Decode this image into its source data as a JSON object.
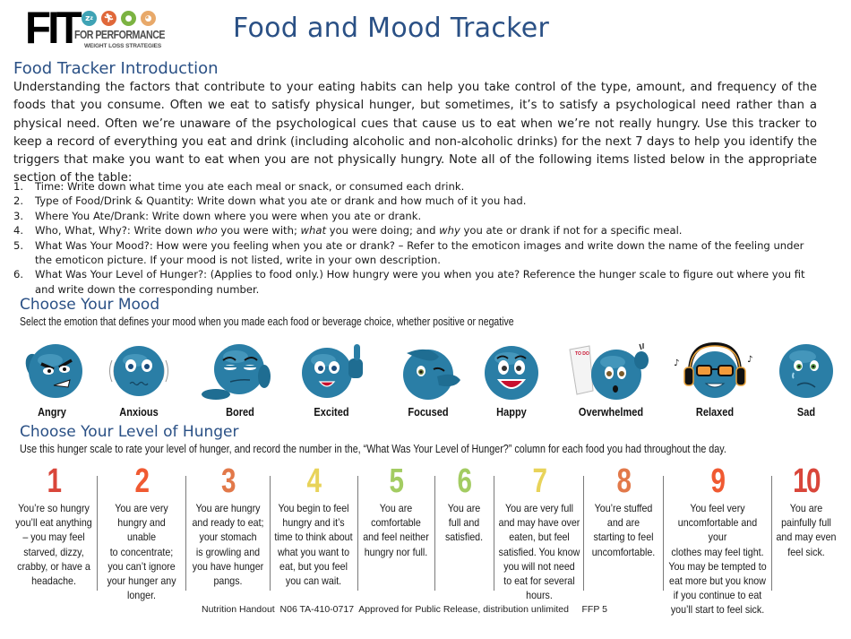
{
  "header": {
    "logo": {
      "main": "FIT",
      "line1": "FOR PERFORMANCE",
      "line2": "WEIGHT LOSS STRATEGIES",
      "icons": [
        {
          "name": "sleep-icon",
          "glyph": "z",
          "color": "#3fa3b5"
        },
        {
          "name": "runner-icon",
          "glyph": "✦",
          "color": "#e0683a"
        },
        {
          "name": "apple-icon",
          "glyph": "●",
          "color": "#7cb342"
        },
        {
          "name": "head-icon",
          "glyph": "◉",
          "color": "#e8a96a"
        }
      ]
    },
    "title": "Food and Mood Tracker"
  },
  "intro": {
    "heading": "Food Tracker Introduction",
    "body": "Understanding the factors that contribute to your eating habits can help you take control of the type, amount, and frequency of the foods that you consume.  Often we eat to satisfy physical hunger, but sometimes, it’s to satisfy a psychological need rather than a physical need. Often we’re unaware of the psychological cues that cause us to eat when we’re not really hungry. Use this tracker to keep a record of everything you eat and drink (including alcoholic and non-alcoholic drinks) for the next 7 days to help you identify the triggers that make you want to eat when you are not physically hungry.  Note all of the following items listed below in the appropriate section of the table:",
    "items": [
      {
        "num": "1.",
        "text": "Time: Write down what time you ate each meal or snack, or consumed each drink."
      },
      {
        "num": "2.",
        "text": "Type of Food/Drink & Quantity: Write down what you ate or drank and how much of it you had."
      },
      {
        "num": "3.",
        "text": "Where You Ate/Drank: Write down where you were when you ate or drank."
      },
      {
        "num": "4.",
        "pre": "Who, What, Why?: Write down ",
        "em1": "who",
        "mid1": " you were with; ",
        "em2": "what",
        "mid2": " you were doing; and ",
        "em3": "why",
        "post": " you ate or drank if not for a specific meal."
      },
      {
        "num": "5.",
        "text": "What Was Your Mood?: How were you feeling when you ate or drank? – Refer to the emoticon images and write down the name of the feeling under the emoticon picture. If your mood is not listed, write in your own description."
      },
      {
        "num": "6.",
        "text": "What Was Your Level of Hunger?: (Applies to food only.) How hungry were you when you ate? Reference the hunger scale to figure out where you fit and write down the corresponding number."
      }
    ]
  },
  "mood": {
    "heading": "Choose Your Mood",
    "subtitle": "Select the emotion that defines your mood when you made each food or beverage choice, whether positive or negative",
    "face_color": "#2a7ea6",
    "options": [
      {
        "label": "Angry",
        "icon": "angry-face-icon"
      },
      {
        "label": "Anxious",
        "icon": "anxious-face-icon"
      },
      {
        "label": "Bored",
        "icon": "bored-face-icon"
      },
      {
        "label": "Excited",
        "icon": "excited-face-icon"
      },
      {
        "label": "Focused",
        "icon": "focused-face-icon"
      },
      {
        "label": "Happy",
        "icon": "happy-face-icon"
      },
      {
        "label": "Overwhelmed",
        "icon": "overwhelmed-face-icon"
      },
      {
        "label": "Relaxed",
        "icon": "relaxed-face-icon"
      },
      {
        "label": "Sad",
        "icon": "sad-face-icon"
      }
    ]
  },
  "hunger": {
    "heading": "Choose Your Level of Hunger",
    "subtitle": "Use this hunger scale to rate your level of hunger, and record the number in the, “What Was Your Level of Hunger?” column for each food you had throughout the day.",
    "levels": [
      {
        "value": "1",
        "color": "#d9463a",
        "desc": "You’re so hungry\nyou’ll eat anything\n– you may feel\nstarved, dizzy,\ncrabby, or have a\nheadache."
      },
      {
        "value": "2",
        "color": "#f05a32",
        "desc": "You are very\nhungry and unable\nto concentrate;\nyou can’t ignore\nyour hunger any\nlonger."
      },
      {
        "value": "3",
        "color": "#e2794a",
        "desc": "You are hungry\nand ready to eat;\nyour stomach\nis growling and\nyou have hunger\npangs."
      },
      {
        "value": "4",
        "color": "#e8d35a",
        "desc": "You begin to feel\nhungry and it’s\ntime to think about\nwhat you want to\neat, but you feel\nyou can wait."
      },
      {
        "value": "5",
        "color": "#a3cc62",
        "desc": "You are\ncomfortable\nand feel neither\nhungry nor full."
      },
      {
        "value": "6",
        "color": "#a3cc62",
        "desc": "You are\nfull and\nsatisfied."
      },
      {
        "value": "7",
        "color": "#e8d35a",
        "desc": "You are very full\nand may have over\neaten, but feel\nsatisfied. You know\nyou will not need\nto eat for several\nhours."
      },
      {
        "value": "8",
        "color": "#e2794a",
        "desc": "You’re stuffed\nand are\nstarting to feel\nuncomfortable."
      },
      {
        "value": "9",
        "color": "#f05a32",
        "desc": "You feel very\nuncomfortable and your\nclothes may feel tight.\nYou may be tempted to\neat more but you know\nif you continue to eat\nyou’ll start to feel sick."
      },
      {
        "value": "10",
        "color": "#d9463a",
        "desc": "You are\npainfully full\nand may even\nfeel sick."
      }
    ]
  },
  "footer": {
    "text": "Nutrition Handout  N06 TA-410-0717  Approved for Public Release, distribution unlimited     FFP 5"
  }
}
